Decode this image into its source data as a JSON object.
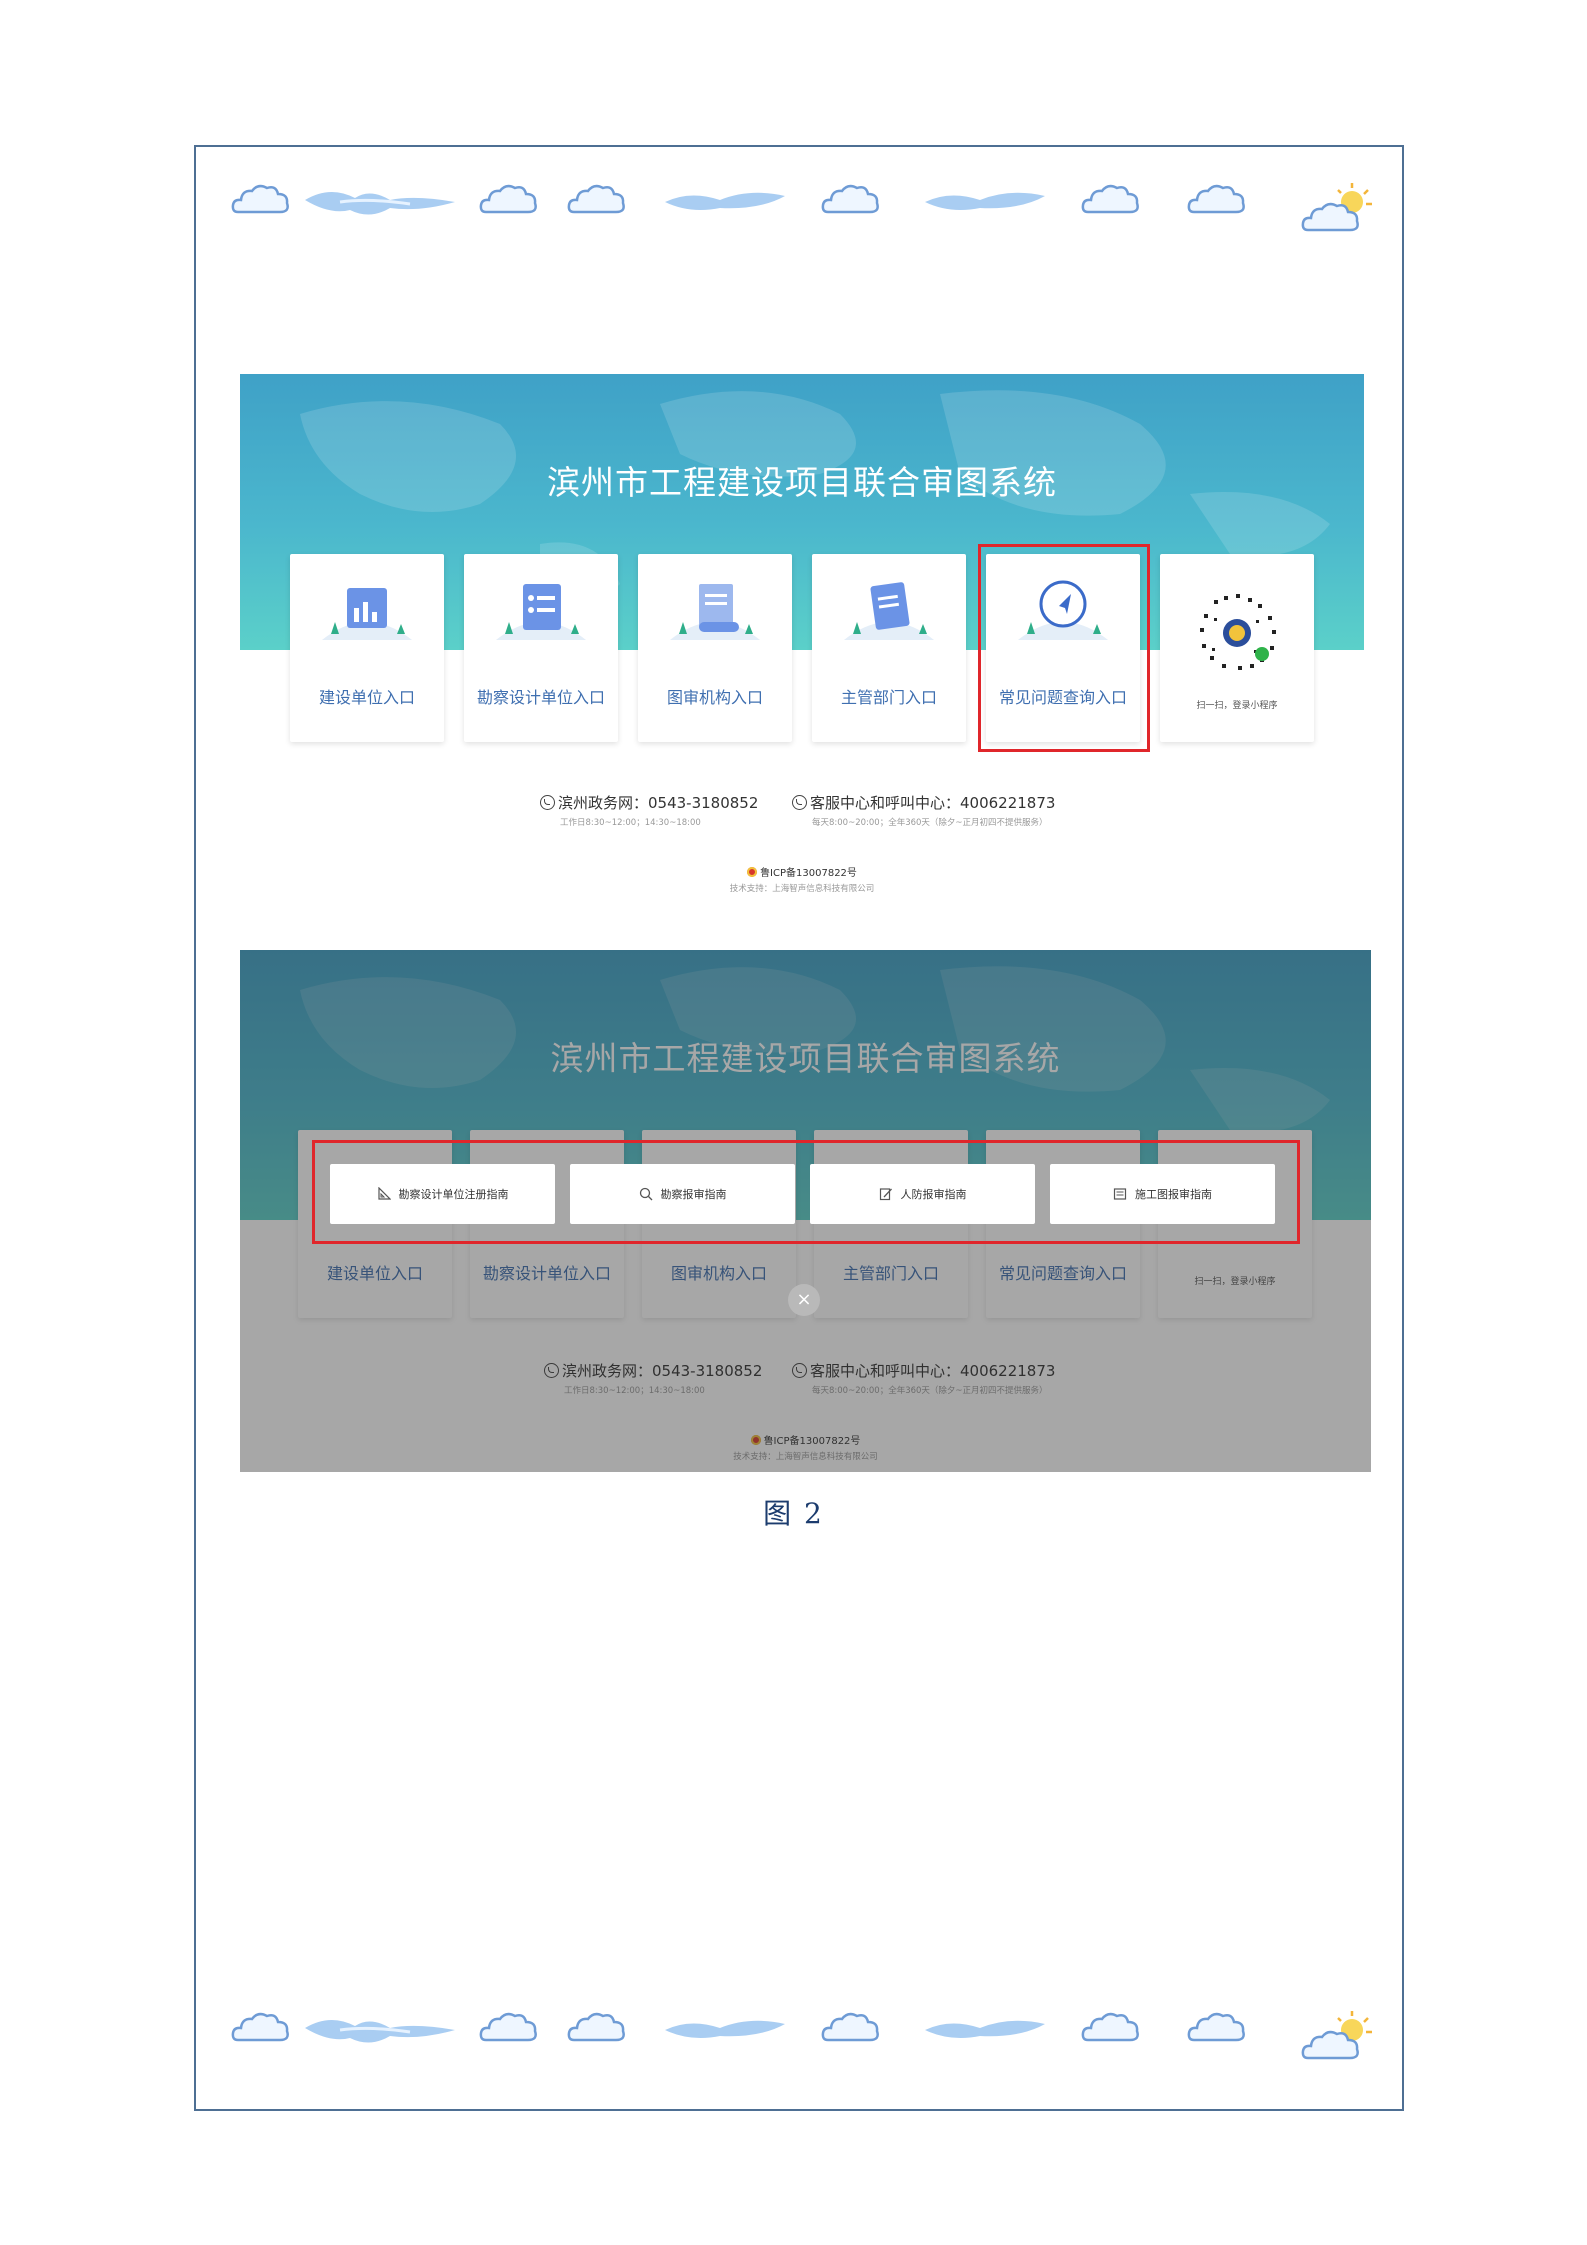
{
  "system_title": "滨州市工程建设项目联合审图系统",
  "entry_cards": [
    {
      "label": "建设单位入口",
      "icon": "building-chart-icon"
    },
    {
      "label": "勘察设计单位入口",
      "icon": "document-list-icon"
    },
    {
      "label": "图审机构入口",
      "icon": "scroll-icon"
    },
    {
      "label": "主管部门入口",
      "icon": "clipboard-icon"
    },
    {
      "label": "常见问题查询入口",
      "icon": "compass-icon"
    }
  ],
  "qr_caption": "扫一扫，登录小程序",
  "contacts": {
    "gov_line": "滨州政务网：0543-3180852",
    "gov_hours": "工作日8:30~12:00；14:30~18:00",
    "service_line": "客服中心和呼叫中心：4006221873",
    "service_hours": "每天8:00~20:00；全年360天（除夕~正月初四不提供服务）"
  },
  "icp": "鲁ICP备13007822号",
  "support": "技术支持：上海智声信息科技有限公司",
  "guide_buttons": [
    {
      "label": "勘察设计单位注册指南",
      "icon": "ruler-icon"
    },
    {
      "label": "勘察报审指南",
      "icon": "magnifier-icon"
    },
    {
      "label": "人防报审指南",
      "icon": "edit-icon"
    },
    {
      "label": "施工图报审指南",
      "icon": "image-icon"
    }
  ],
  "close_symbol": "×",
  "figure_caption": "图 2",
  "colors": {
    "banner": "#4bb7cd",
    "highlight": "#e0262b",
    "label": "#3f6fb0",
    "frame": "#4e6f93"
  }
}
